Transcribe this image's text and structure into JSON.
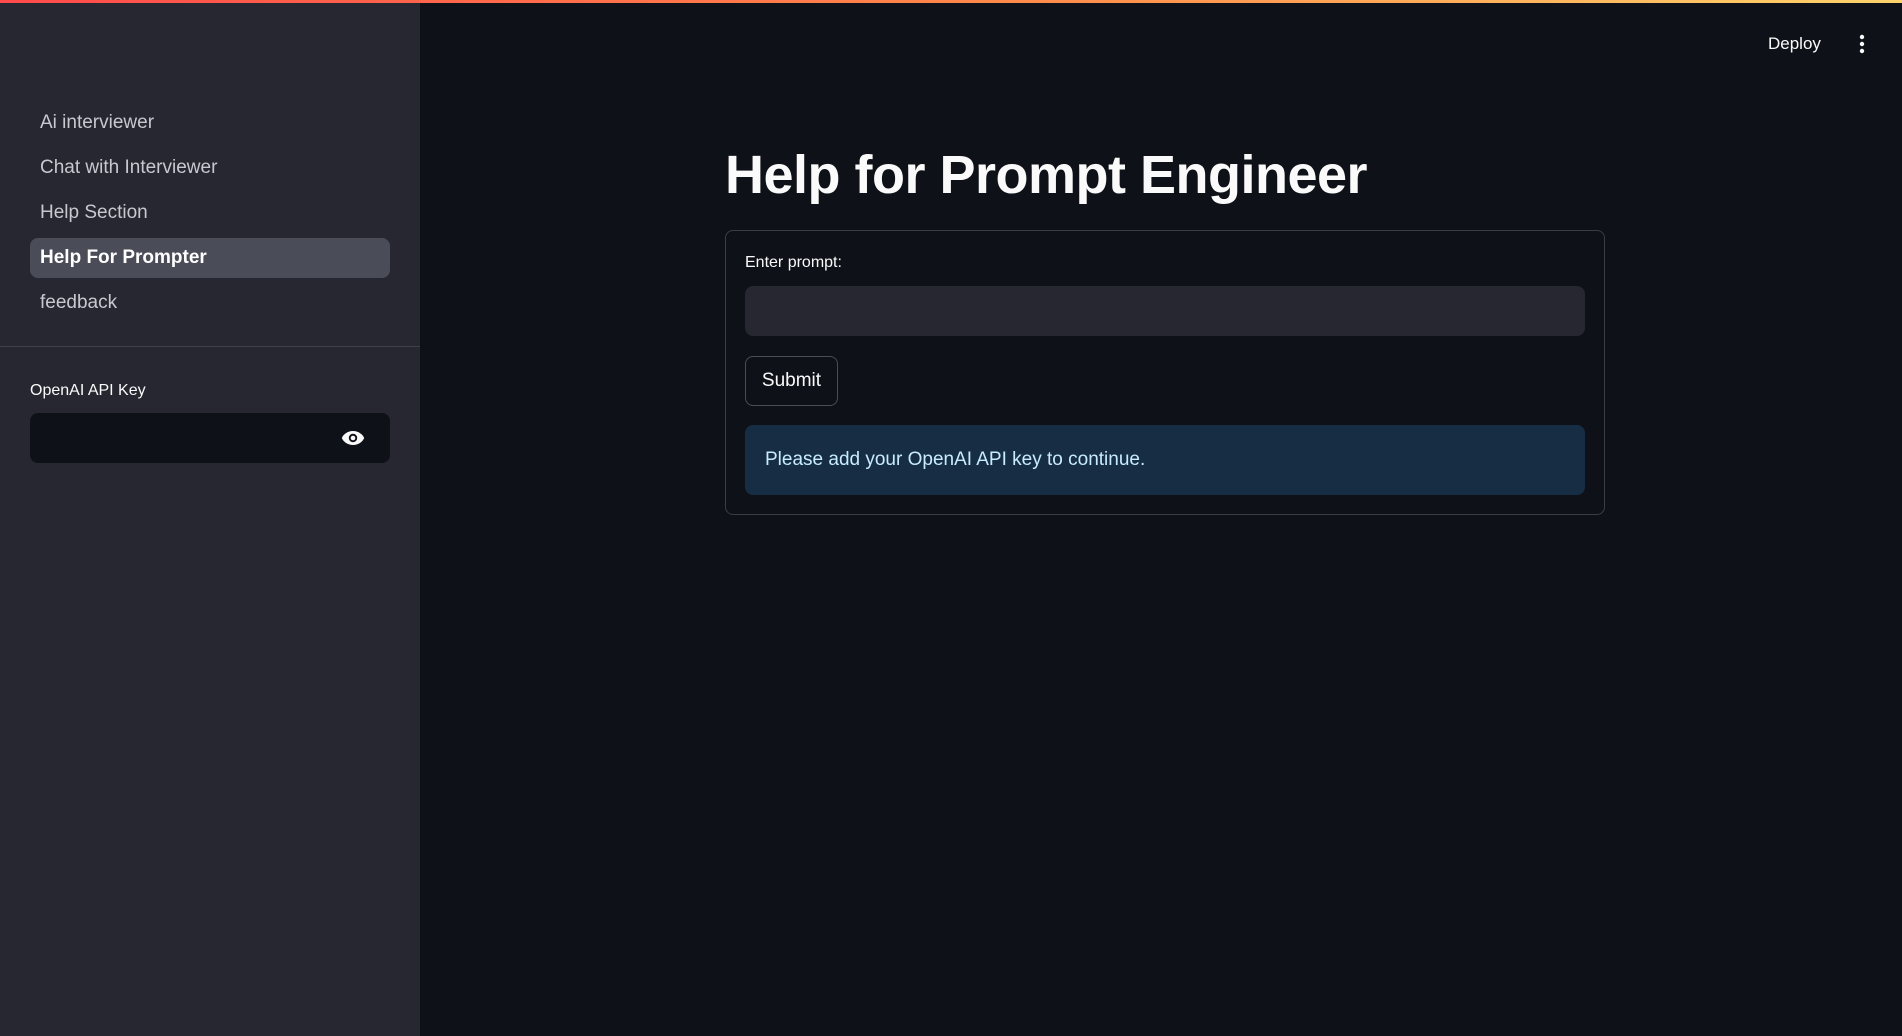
{
  "header": {
    "deploy_label": "Deploy",
    "menu_icon": "vertical-dots-icon"
  },
  "sidebar": {
    "items": [
      {
        "label": "Ai interviewer",
        "active": false
      },
      {
        "label": "Chat with Interviewer",
        "active": false
      },
      {
        "label": "Help Section",
        "active": false
      },
      {
        "label": "Help For Prompter",
        "active": true
      },
      {
        "label": "feedback",
        "active": false
      }
    ],
    "api_key": {
      "label": "OpenAI API Key",
      "value": "",
      "placeholder": "",
      "toggle_icon": "eye-icon"
    }
  },
  "main": {
    "title": "Help for Prompt Engineer",
    "form": {
      "prompt_label": "Enter prompt:",
      "prompt_value": "",
      "submit_label": "Submit"
    },
    "info_message": "Please add your OpenAI API key to continue."
  },
  "colors": {
    "background": "#0e1117",
    "sidebar": "#262730",
    "active_item": "#4a4c57",
    "info_bg": "#172d43",
    "info_text": "#c7ebff",
    "accent": "#ff4b4b"
  }
}
